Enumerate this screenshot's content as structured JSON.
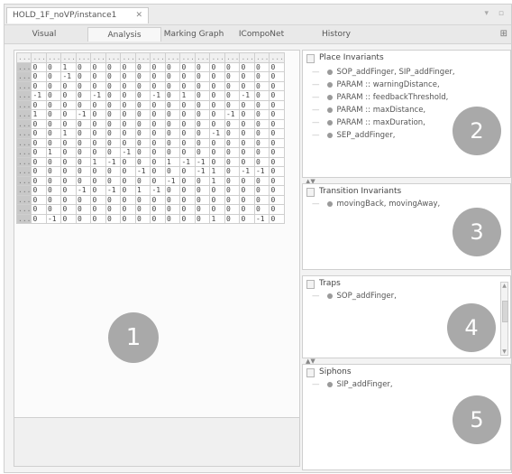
{
  "document_tab": {
    "title": "HOLD_1F_noVP/instance1",
    "close_glyph": "✕"
  },
  "window_controls": "▾ ▫",
  "view_tabs": [
    {
      "label": "Visual"
    },
    {
      "label": "Analysis",
      "active": true
    },
    {
      "label": "Marking Graph"
    },
    {
      "label": "ICompoNet"
    },
    {
      "label": "History"
    }
  ],
  "matrix": {
    "header_cell": "...",
    "row_header_cell": "...",
    "column_count": 17,
    "rows": [
      [
        "0",
        "0",
        "1",
        "0",
        "0",
        "0",
        "0",
        "0",
        "0",
        "0",
        "0",
        "0",
        "0",
        "0",
        "0",
        "0",
        "0"
      ],
      [
        "0",
        "0",
        "-1",
        "0",
        "0",
        "0",
        "0",
        "0",
        "0",
        "0",
        "0",
        "0",
        "0",
        "0",
        "0",
        "0",
        "0"
      ],
      [
        "0",
        "0",
        "0",
        "0",
        "0",
        "0",
        "0",
        "0",
        "0",
        "0",
        "0",
        "0",
        "0",
        "0",
        "0",
        "0",
        "0"
      ],
      [
        "-1",
        "0",
        "0",
        "0",
        "-1",
        "0",
        "0",
        "0",
        "-1",
        "0",
        "1",
        "0",
        "0",
        "0",
        "-1",
        "0",
        "0"
      ],
      [
        "0",
        "0",
        "0",
        "0",
        "0",
        "0",
        "0",
        "0",
        "0",
        "0",
        "0",
        "0",
        "0",
        "0",
        "0",
        "0",
        "0"
      ],
      [
        "1",
        "0",
        "0",
        "-1",
        "0",
        "0",
        "0",
        "0",
        "0",
        "0",
        "0",
        "0",
        "0",
        "-1",
        "0",
        "0",
        "0"
      ],
      [
        "0",
        "0",
        "0",
        "0",
        "0",
        "0",
        "0",
        "0",
        "0",
        "0",
        "0",
        "0",
        "0",
        "0",
        "0",
        "0",
        "0"
      ],
      [
        "0",
        "0",
        "1",
        "0",
        "0",
        "0",
        "0",
        "0",
        "0",
        "0",
        "0",
        "0",
        "-1",
        "0",
        "0",
        "0",
        "0"
      ],
      [
        "0",
        "0",
        "0",
        "0",
        "0",
        "0",
        "0",
        "0",
        "0",
        "0",
        "0",
        "0",
        "0",
        "0",
        "0",
        "0",
        "0"
      ],
      [
        "0",
        "1",
        "0",
        "0",
        "0",
        "0",
        "-1",
        "0",
        "0",
        "0",
        "0",
        "0",
        "0",
        "0",
        "0",
        "0",
        "0"
      ],
      [
        "0",
        "0",
        "0",
        "0",
        "1",
        "-1",
        "0",
        "0",
        "0",
        "1",
        "-1",
        "-1",
        "0",
        "0",
        "0",
        "0",
        "0"
      ],
      [
        "0",
        "0",
        "0",
        "0",
        "0",
        "0",
        "0",
        "-1",
        "0",
        "0",
        "0",
        "-1",
        "1",
        "0",
        "-1",
        "-1",
        "0"
      ],
      [
        "0",
        "0",
        "0",
        "0",
        "0",
        "0",
        "0",
        "0",
        "0",
        "-1",
        "0",
        "0",
        "1",
        "0",
        "0",
        "0",
        "0"
      ],
      [
        "0",
        "0",
        "0",
        "-1",
        "0",
        "-1",
        "0",
        "1",
        "-1",
        "0",
        "0",
        "0",
        "0",
        "0",
        "0",
        "0",
        "0"
      ],
      [
        "0",
        "0",
        "0",
        "0",
        "0",
        "0",
        "0",
        "0",
        "0",
        "0",
        "0",
        "0",
        "0",
        "0",
        "0",
        "0",
        "0"
      ],
      [
        "0",
        "0",
        "0",
        "0",
        "0",
        "0",
        "0",
        "0",
        "0",
        "0",
        "0",
        "0",
        "0",
        "0",
        "0",
        "0",
        "0"
      ],
      [
        "0",
        "-1",
        "0",
        "0",
        "0",
        "0",
        "0",
        "0",
        "0",
        "0",
        "0",
        "0",
        "1",
        "0",
        "0",
        "-1",
        "0"
      ]
    ]
  },
  "callouts": {
    "c1": "1",
    "c2": "2",
    "c3": "3",
    "c4": "4",
    "c5": "5"
  },
  "panels": {
    "place_invariants": {
      "title": "Place Invariants",
      "items": [
        "SOP_addFinger, SIP_addFinger,",
        "PARAM :: warningDistance,",
        "PARAM :: feedbackThreshold,",
        "PARAM :: maxDistance,",
        "PARAM :: maxDuration,",
        "SEP_addFinger,"
      ]
    },
    "transition_invariants": {
      "title": "Transition Invariants",
      "items": [
        "movingBack, movingAway,"
      ]
    },
    "traps": {
      "title": "Traps",
      "items": [
        "SOP_addFinger,"
      ]
    },
    "siphons": {
      "title": "Siphons",
      "items": [
        "SIP_addFinger,"
      ]
    }
  },
  "colors": {
    "callout": "#a9a9a9",
    "row_header": "#c8c8c8"
  },
  "icons": {
    "pin": "pin-icon",
    "splitter": "splitter-arrows-icon"
  }
}
